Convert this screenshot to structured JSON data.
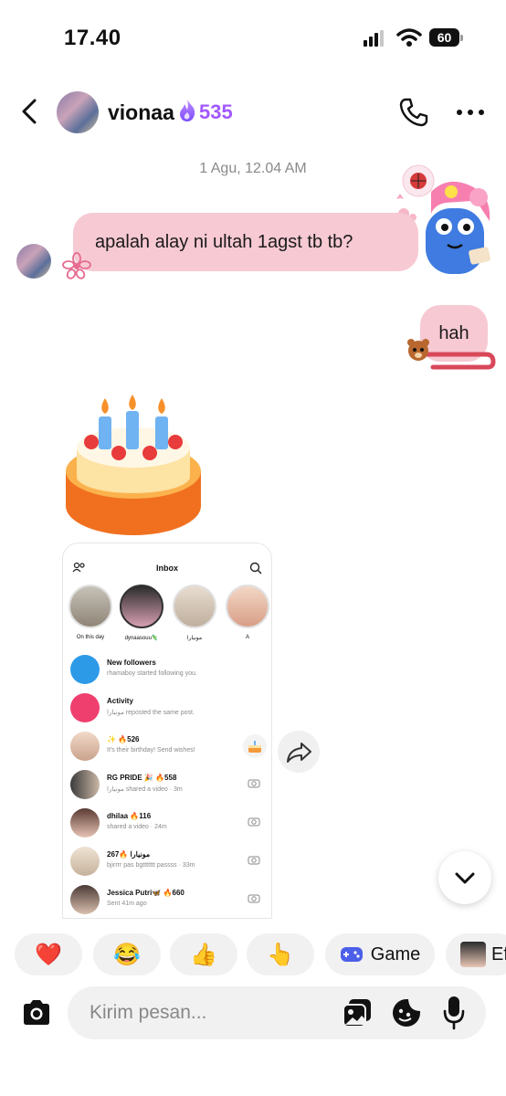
{
  "status_bar": {
    "time": "17.40",
    "battery": "60",
    "icons": [
      "signal-icon",
      "wifi-icon",
      "battery-icon"
    ]
  },
  "header": {
    "contact_name": "vionaa",
    "streak_count": "535",
    "streak_color": "#a259ff",
    "icons": [
      "back-icon",
      "flame-icon",
      "phone-icon",
      "more-icon"
    ]
  },
  "conversation": {
    "timestamp": "1 Agu, 12.04 AM",
    "incoming_message": "apalah alay ni ultah 1agst tb tb?",
    "outgoing_message": "hah",
    "bubble_color": "#f7c9d3"
  },
  "shared_screenshot": {
    "title": "Inbox",
    "stories": [
      {
        "label": "On this day"
      },
      {
        "label": "dynaasouu🦎"
      },
      {
        "label": "مونيارا"
      },
      {
        "label": "A"
      }
    ],
    "rows": [
      {
        "title": "New followers",
        "subtitle": "rhamaboy started following you."
      },
      {
        "title": "Activity",
        "subtitle": "مونيارا reposted the same post."
      },
      {
        "title": "✨ 🔥526",
        "subtitle": "It's their birthday! Send wishes!"
      },
      {
        "title": "RG PRIDE 🎉 🔥558",
        "subtitle": "مونيارا shared a video · 3m"
      },
      {
        "title": "dhilaa 🔥116",
        "subtitle": "shared a video · 24m"
      },
      {
        "title": "مونيارا 🔥267",
        "subtitle": "bjirrrr pas bgttttttt passss · 33m"
      },
      {
        "title": "Jessica Putri🦋 🔥660",
        "subtitle": "Sent 41m ago"
      }
    ]
  },
  "reactions": {
    "heart": "❤️",
    "laugh": "😂",
    "thumbs_up": "👍",
    "point": "👆",
    "game_label": "Game",
    "effects_label": "Ef"
  },
  "composer": {
    "placeholder": "Kirim pesan...",
    "icons": [
      "camera-icon",
      "gallery-icon",
      "sticker-icon",
      "mic-icon"
    ]
  }
}
